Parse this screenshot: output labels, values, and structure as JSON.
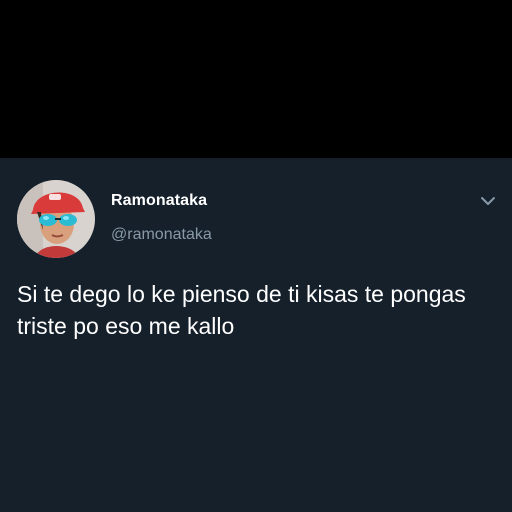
{
  "theme": {
    "top_band_color": "#000000",
    "card_background": "#15202b",
    "text_primary": "#ffffff",
    "text_secondary": "#8899a6",
    "chevron_color": "#8899a6"
  },
  "tweet": {
    "display_name": "Ramonataka",
    "handle": "@ramonataka",
    "text": "Si te dego lo ke pienso de ti kisas te pongas triste po eso me kallo",
    "avatar_icon": "user-avatar-photo",
    "menu_icon": "chevron-down-icon"
  }
}
